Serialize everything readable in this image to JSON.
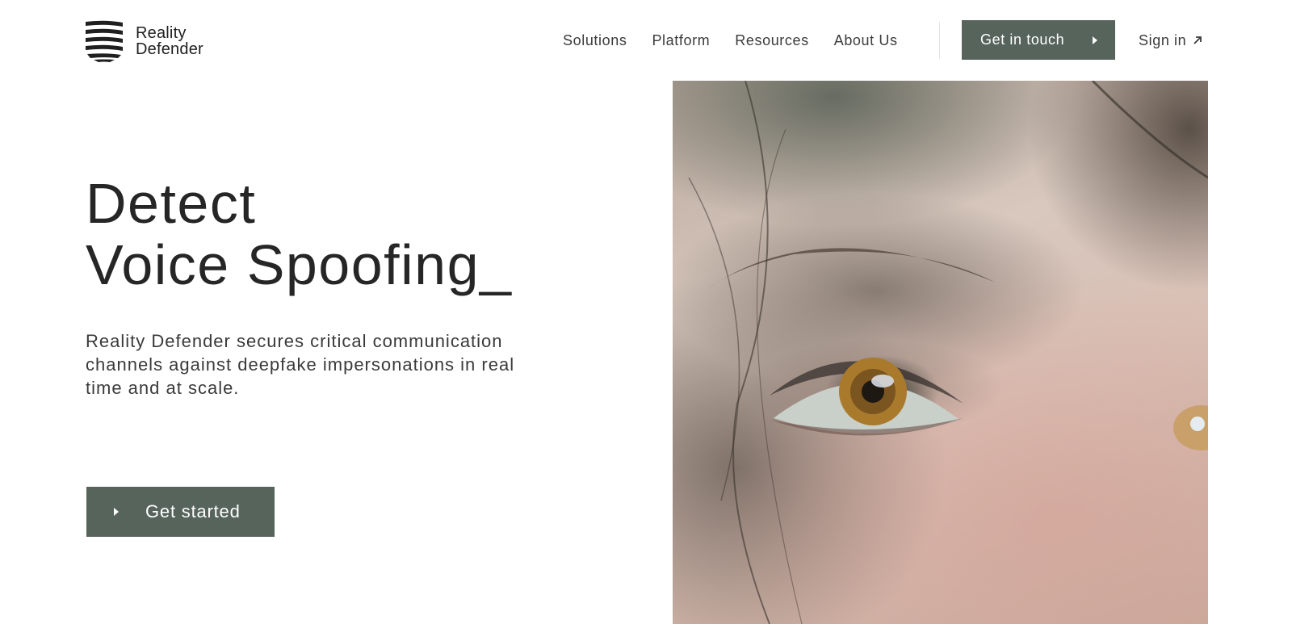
{
  "brand": {
    "name_line1": "Reality",
    "name_line2": "Defender"
  },
  "nav": {
    "items": [
      "Solutions",
      "Platform",
      "Resources",
      "About Us"
    ],
    "cta_label": "Get in touch",
    "signin_label": "Sign in"
  },
  "hero": {
    "headline_line1": "Detect",
    "headline_line2": "Voice Spoofing_",
    "subtext": "Reality Defender secures critical communication channels against deepfake impersonations in real time and at scale.",
    "cta_label": "Get started"
  },
  "colors": {
    "accent": "#56645b",
    "text": "#262626",
    "background": "#ffffff"
  },
  "icons": {
    "logo": "stacked-waves-logo-icon",
    "cta_arrow": "play-triangle-icon",
    "external": "arrow-up-right-icon"
  }
}
